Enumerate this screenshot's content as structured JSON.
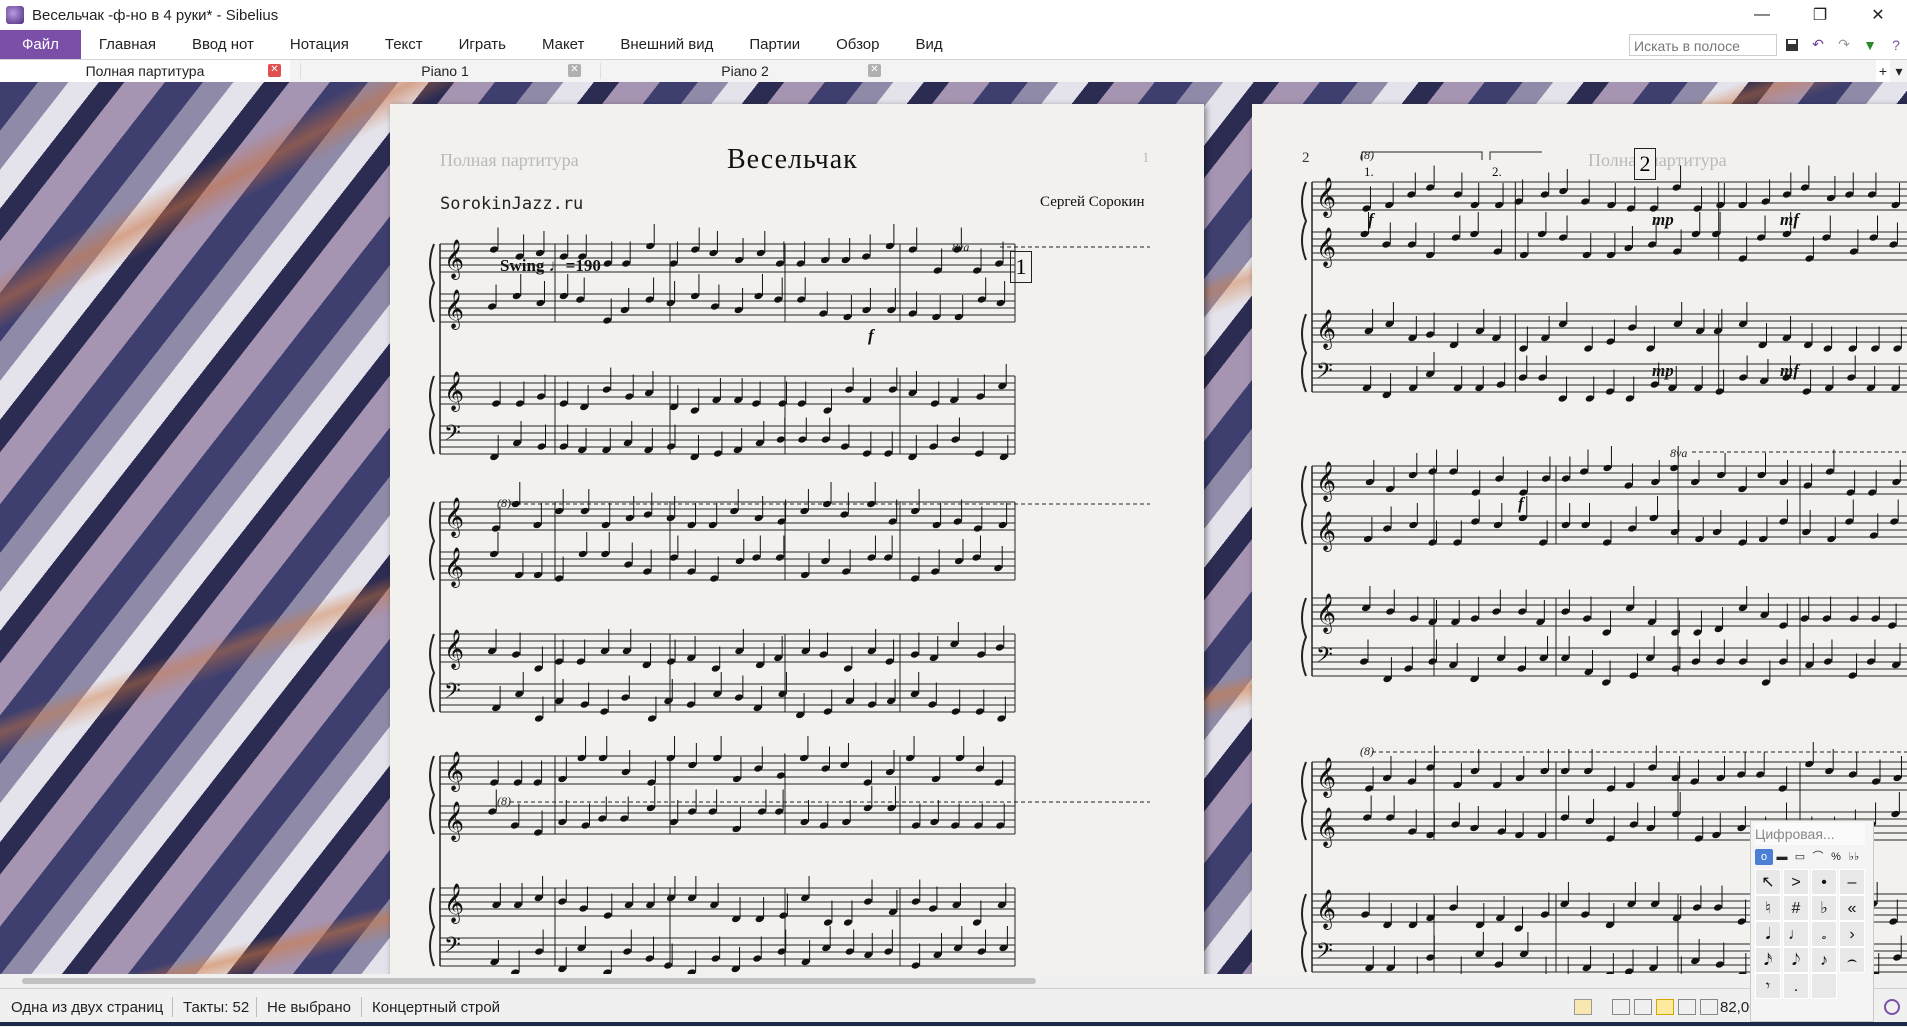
{
  "window": {
    "title": "Весельчак -ф-но в 4 руки* - Sibelius",
    "controls": [
      "—",
      "❐",
      "✕"
    ]
  },
  "menu": {
    "items": [
      "Файл",
      "Главная",
      "Ввод нот",
      "Нотация",
      "Текст",
      "Играть",
      "Макет",
      "Внешний вид",
      "Партии",
      "Обзор",
      "Вид"
    ],
    "search_placeholder": "Искать в полосе",
    "quick_access": [
      "save-icon",
      "undo-icon",
      "redo-icon",
      "dropdown-icon",
      "help-icon"
    ]
  },
  "tabs": [
    {
      "label": "Полная партитура",
      "active": true
    },
    {
      "label": "Piano 1",
      "active": false
    },
    {
      "label": "Piano 2",
      "active": false
    }
  ],
  "tabbar_buttons": [
    "+",
    "▾"
  ],
  "score": {
    "page1": {
      "header_part": "Полная партитура",
      "page_number": "1",
      "title": "Весельчак",
      "site": "SorokinJazz.ru",
      "composer": "Сергей Сорокин",
      "tempo": "Swing ♩=190",
      "rehearsal_mark": "1",
      "ottava": "8va",
      "ottava_cont": "(8)",
      "dynamic": "f"
    },
    "page2": {
      "page_number": "2",
      "header_part": "Полная партитура",
      "rehearsal_mark": "2",
      "ottava_cont": "(8)",
      "ottava": "8va",
      "volta1": "1.",
      "volta2": "2.",
      "dyn_f": "f",
      "dyn_mp": "mp",
      "dyn_mf": "mf"
    }
  },
  "statusbar": {
    "page_info": "Одна из двух страниц",
    "bars": "Такты: 52",
    "selection": "Не выбрано",
    "pitch": "Концертный строй",
    "zoom": "82,00"
  },
  "keypad": {
    "title": "Цифровая...",
    "tabs": [
      "o",
      "▬",
      "▭",
      "⌒",
      "%",
      "♭♭"
    ],
    "keys": [
      "↖",
      ">",
      "•",
      "–",
      "♮",
      "#",
      "♭",
      "«",
      "𝅘𝅥",
      "♩",
      "𝅗",
      "›",
      "𝅘𝅥𝅯",
      "𝅘𝅥𝅮",
      "♪",
      "⌢",
      "𝄾",
      ".",
      ""
    ]
  },
  "colors": {
    "accent": "#7b4fa8",
    "tab_close_active": "#e05050",
    "paper": "#f2f1ed"
  }
}
